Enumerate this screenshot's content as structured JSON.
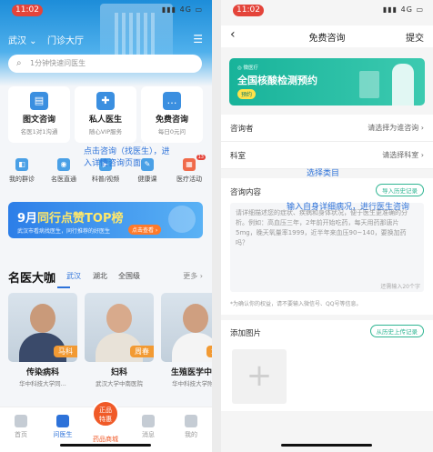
{
  "left": {
    "status": {
      "time": "11:02",
      "icons": "▮▮▮ 4G ▭"
    },
    "header": {
      "location": "武汉 ⌄",
      "tab": "门诊大厅",
      "menu_icon": "menu-icon"
    },
    "search": {
      "placeholder": "1分钟快速问医生"
    },
    "cards": [
      {
        "title": "图文咨询",
        "sub": "名医1对1沟通",
        "icon": "chat-doc-icon"
      },
      {
        "title": "私人医生",
        "sub": "随心VIP服务",
        "icon": "doctor-icon"
      },
      {
        "title": "免费咨询",
        "sub": "每日0元问",
        "icon": "free-chat-icon"
      }
    ],
    "shortcuts": [
      {
        "label": "我的群诊",
        "badge": ""
      },
      {
        "label": "名医直通",
        "badge": ""
      },
      {
        "label": "科普/视频",
        "badge": ""
      },
      {
        "label": "健康课",
        "badge": ""
      },
      {
        "label": "医疗活动",
        "badge": "13"
      }
    ],
    "annotation": "点击咨询（找医生），进入详情咨询页面",
    "banner": {
      "title_month": "9月",
      "title_rest": "同行点赞TOP榜",
      "subtitle": "武汉市看病找医生，同行推荐的好医生",
      "cta": "点击查看 ›"
    },
    "section": {
      "title": "名医大咖",
      "tabs": [
        "武汉",
        "湖北",
        "全国级"
      ],
      "more": "更多 ›"
    },
    "doctors": [
      {
        "tag": "马科",
        "dept": "传染病科",
        "hospital": "华中科技大学同..."
      },
      {
        "tag": "周春",
        "dept": "妇科",
        "hospital": "武汉大学中南医院"
      },
      {
        "tag": "章汉",
        "dept": "生殖医学中心",
        "hospital": "华中科技大学附..."
      }
    ],
    "tabbar": [
      "首页",
      "问医生",
      "药品商城",
      "消息",
      "我的"
    ],
    "center_button": [
      "正品",
      "特惠"
    ]
  },
  "right": {
    "status": {
      "time": "11:02",
      "icons": "▮▮▮ 4G ▭"
    },
    "nav": {
      "back": "‹",
      "title": "免费咨询",
      "submit": "提交"
    },
    "banner": {
      "brand": "◎ 微医疗",
      "title": "全国核酸检测预约",
      "cta": "预约"
    },
    "rows": [
      {
        "label": "咨询者",
        "value": "请选择为谁咨询 ›"
      },
      {
        "label": "科室",
        "value": "请选择科室 ›"
      }
    ],
    "annotation_dept": "选择类目",
    "description": {
      "label": "咨询内容",
      "history_button": "导入历史记录",
      "placeholder": "请详细描述您的症状、疾病和身体状况，便于医生更准确的分析。例如：高血压三年，2年前开始吃药，每天用药那唐片5mg，晚天氧量率1999，近半年来血压90~140，要换加药吗？",
      "counter": "还需输入20个字",
      "tip": "*为确认你的权益，请不要输入微信号、QQ号等信息。"
    },
    "annotation_desc": "输入自身详细病况，进行医生咨询",
    "images": {
      "label": "添加图片",
      "upload_button": "从历史上传记录",
      "add_icon": "+"
    }
  }
}
